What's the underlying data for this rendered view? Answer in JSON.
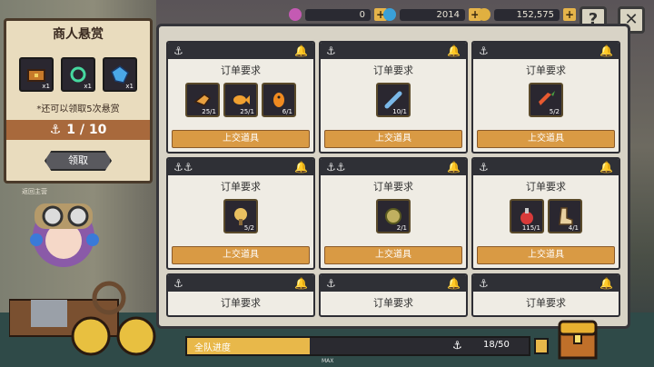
{
  "currency": [
    {
      "value": "0",
      "color": "#c45ab3"
    },
    {
      "value": "2014",
      "color": "#3aa0d8"
    },
    {
      "value": "152,575",
      "color": "#e0b040"
    }
  ],
  "top_buttons": {
    "help": "?",
    "close": "✕"
  },
  "bounty": {
    "title": "商人悬赏",
    "items": [
      {
        "icon": "chest-icon",
        "qty": "x1"
      },
      {
        "icon": "green-ring-icon",
        "qty": "x1"
      },
      {
        "icon": "blue-gem-icon",
        "qty": "x1"
      }
    ],
    "note": "*还可以领取5次悬赏",
    "progress": "1 / 10",
    "claim_label": "领取"
  },
  "back_label": "返回主营",
  "orders": [
    {
      "title": "订单要求",
      "submit": "上交道具",
      "items": [
        {
          "icon": "fish-tail-icon",
          "qty": "25/1"
        },
        {
          "icon": "goldfish-icon",
          "qty": "25/1"
        },
        {
          "icon": "orange-fish-icon",
          "qty": "6/1"
        }
      ]
    },
    {
      "title": "订单要求",
      "submit": "上交道具",
      "items": [
        {
          "icon": "blue-fish-icon",
          "qty": "10/1"
        }
      ]
    },
    {
      "title": "订单要求",
      "submit": "上交道具",
      "items": [
        {
          "icon": "carrot-icon",
          "qty": "5/2"
        }
      ]
    },
    {
      "title": "订单要求",
      "submit": "上交道具",
      "items": [
        {
          "icon": "flower-icon",
          "qty": "5/2"
        }
      ]
    },
    {
      "title": "订单要求",
      "submit": "上交道具",
      "items": [
        {
          "icon": "pufferfish-icon",
          "qty": "2/1"
        }
      ]
    },
    {
      "title": "订单要求",
      "submit": "上交道具",
      "items": [
        {
          "icon": "potion-icon",
          "qty": "115/1"
        },
        {
          "icon": "boot-icon",
          "qty": "4/1"
        }
      ]
    },
    {
      "title": "订单要求"
    },
    {
      "title": "订单要求"
    },
    {
      "title": "订单要求"
    }
  ],
  "team": {
    "label": "全队进度",
    "count": "18/50",
    "progress": 0.36,
    "max_label": "MAX"
  }
}
